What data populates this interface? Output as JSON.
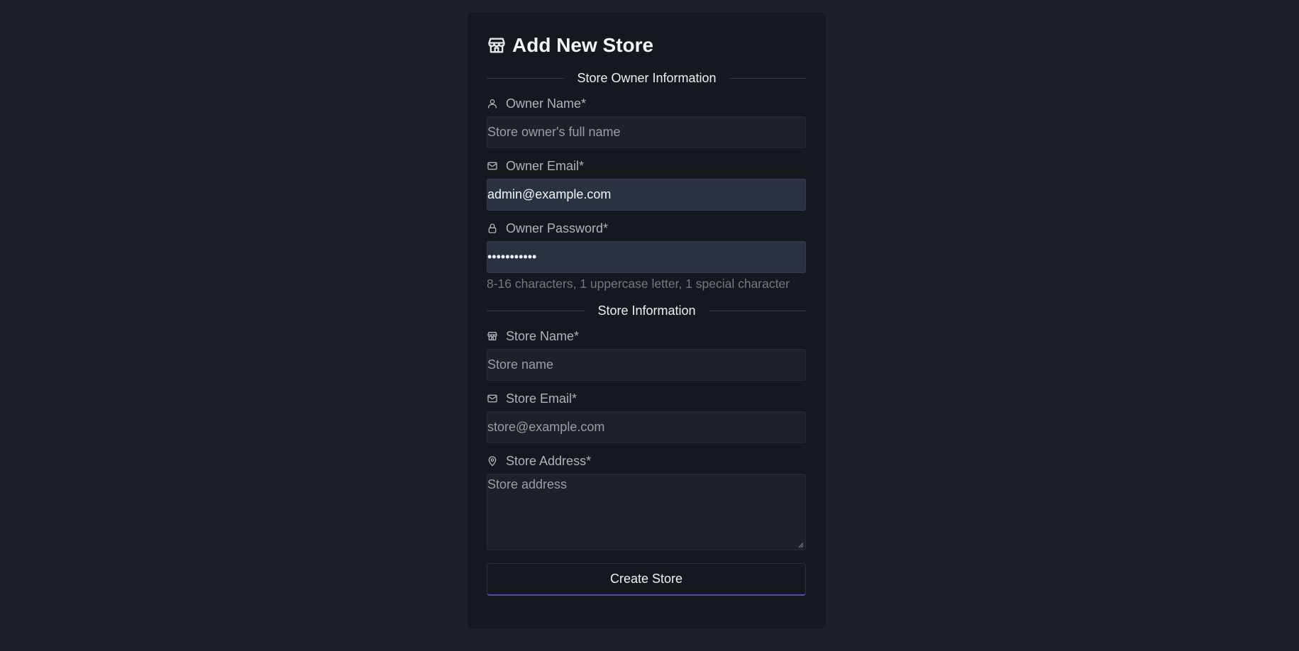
{
  "form": {
    "title": "Add New Store",
    "owner_section": "Store Owner Information",
    "store_section": "Store Information",
    "owner_name": {
      "label": "Owner Name*",
      "placeholder": "Store owner's full name",
      "value": ""
    },
    "owner_email": {
      "label": "Owner Email*",
      "value": "admin@example.com"
    },
    "owner_password": {
      "label": "Owner Password*",
      "value": "•••••••••••",
      "hint": "8-16 characters, 1 uppercase letter, 1 special character"
    },
    "store_name": {
      "label": "Store Name*",
      "placeholder": "Store name",
      "value": ""
    },
    "store_email": {
      "label": "Store Email*",
      "placeholder": "store@example.com",
      "value": ""
    },
    "store_address": {
      "label": "Store Address*",
      "placeholder": "Store address",
      "value": ""
    },
    "submit_label": "Create Store"
  },
  "icons": {
    "title": "store-icon",
    "owner_name": "user-icon",
    "owner_email": "mail-icon",
    "owner_password": "lock-icon",
    "store_name": "store-icon",
    "store_email": "mail-icon",
    "store_address": "map-pin-icon"
  },
  "colors": {
    "page_background": "#1c2028",
    "card_background": "#15181e",
    "filled_input": "#2a3140",
    "button_accent": "#4a57a8"
  }
}
